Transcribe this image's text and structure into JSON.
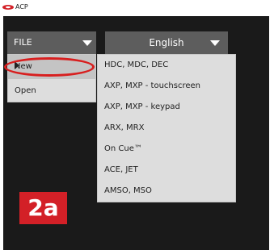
{
  "window": {
    "title": "ACP"
  },
  "toolbar": {
    "file_label": "FILE",
    "language_label": "English"
  },
  "file_menu": {
    "items": [
      {
        "label": "New"
      },
      {
        "label": "Open"
      }
    ]
  },
  "submenu": {
    "items": [
      {
        "label": "HDC, MDC, DEC"
      },
      {
        "label": "AXP, MXP - touchscreen"
      },
      {
        "label": "AXP, MXP - keypad"
      },
      {
        "label": "ARX, MRX"
      },
      {
        "label": "On Cue™"
      },
      {
        "label": "ACE, JET"
      },
      {
        "label": "AMSO, MSO"
      }
    ]
  },
  "annotation": {
    "step_badge": "2a",
    "accent_color": "#d32027"
  },
  "colors": {
    "canvas": "#1a1a1a",
    "button": "#5d5d5d",
    "menu": "#dddddd",
    "highlight": "#c4c4c4"
  }
}
